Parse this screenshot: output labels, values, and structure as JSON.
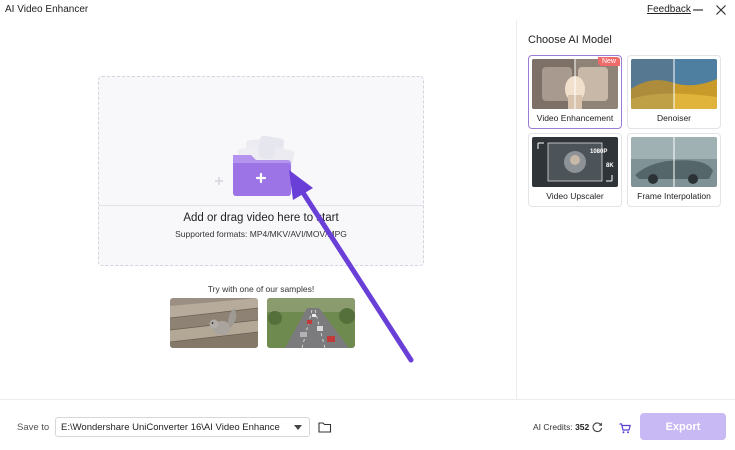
{
  "app": {
    "title": "AI Video Enhancer",
    "feedback_label": "Feedback"
  },
  "dropzone": {
    "title": "Add or drag video here to start",
    "formats": "Supported formats: MP4/MKV/AVI/MOV/MPG",
    "icon": "folder-plus-icon"
  },
  "samples": {
    "label": "Try with one of our samples!",
    "items": [
      {
        "name": "squirrel-sample"
      },
      {
        "name": "highway-sample"
      }
    ]
  },
  "panel": {
    "title": "Choose AI Model",
    "models": [
      {
        "label": "Video Enhancement",
        "selected": true,
        "badge": "New"
      },
      {
        "label": "Denoiser",
        "selected": false
      },
      {
        "label": "Video Upscaler",
        "selected": false,
        "overlay_1": "1080P",
        "overlay_2": "8K"
      },
      {
        "label": "Frame Interpolation",
        "selected": false
      }
    ]
  },
  "footer": {
    "save_label": "Save to",
    "save_path": "E:\\Wondershare UniConverter 16\\AI Video Enhance",
    "credits_label": "AI Credits:",
    "credits_value": "352",
    "export_label": "Export"
  },
  "colors": {
    "accent": "#7b4de0",
    "export_disabled": "#c8b8f4",
    "arrow": "#6a3fd8",
    "badge": "#f06a6a"
  }
}
